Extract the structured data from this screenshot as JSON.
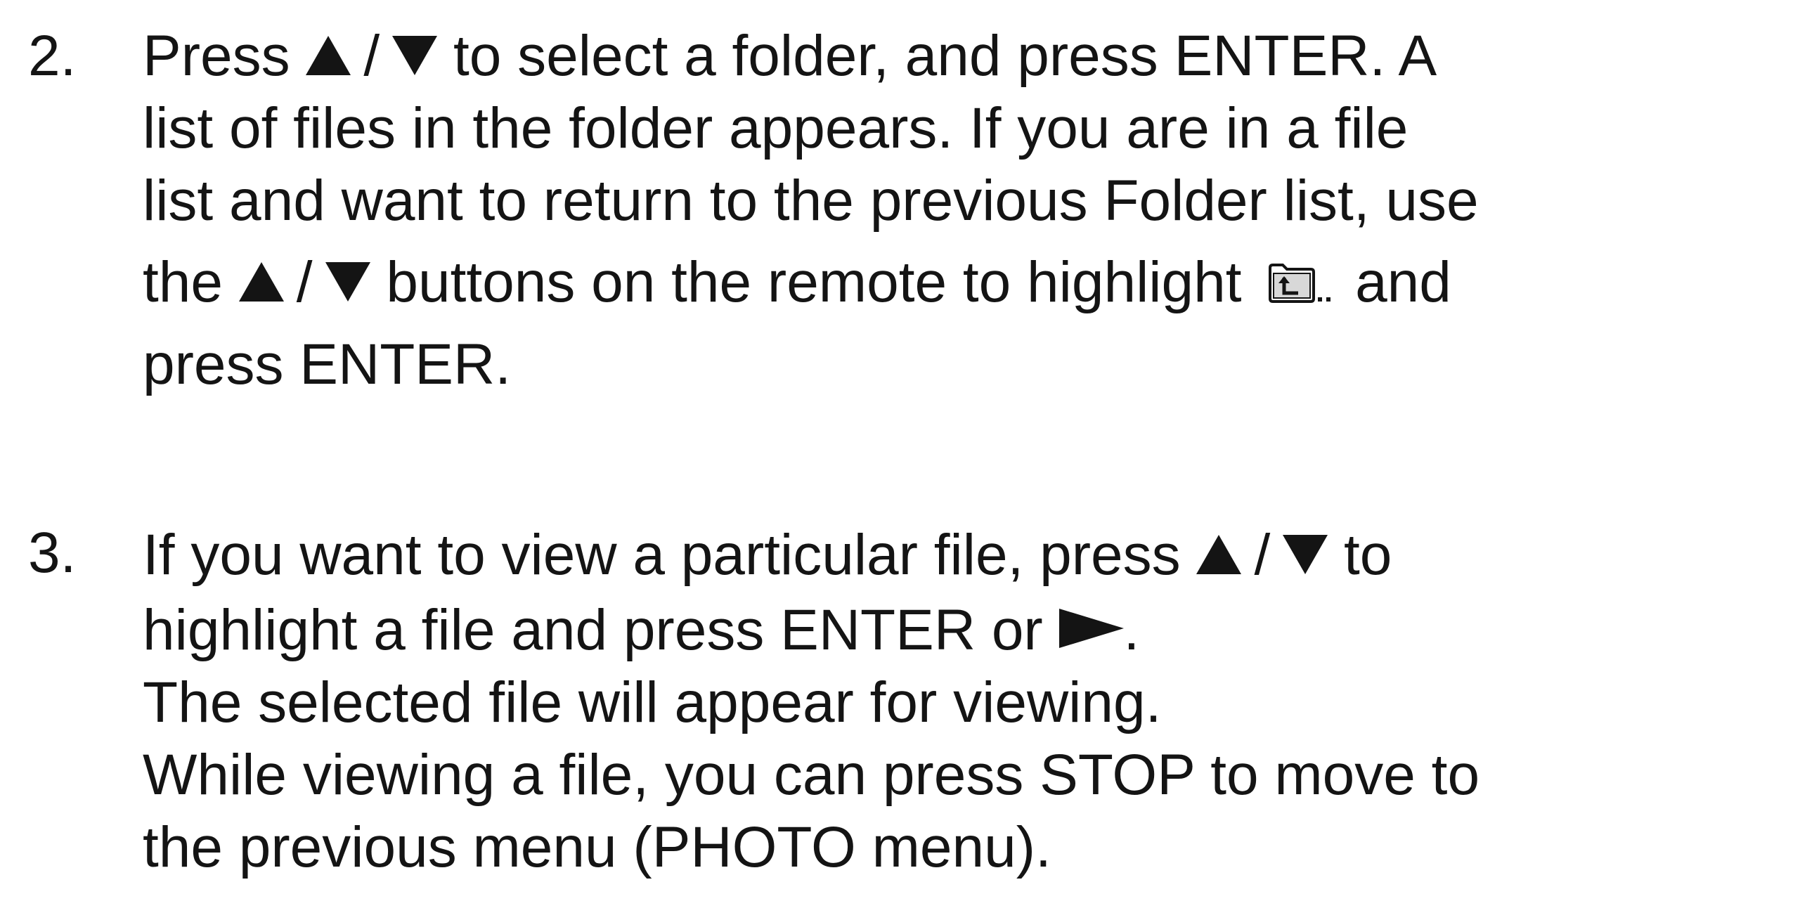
{
  "step2": {
    "number": "2.",
    "line1": {
      "pre": "Press ",
      "slash": "/",
      "post": " to select a folder, and press ENTER. A"
    },
    "line2": "list of files in the folder appears. If you are in a file",
    "line3": "list and want to return to the previous Folder list, use",
    "line4": {
      "pre": "the ",
      "slash": "/",
      "mid": " buttons on the remote to highlight ",
      "post": " and"
    },
    "line5": "press ENTER."
  },
  "step3": {
    "number": "3.",
    "line1": {
      "pre": "If you want to view a particular file, press ",
      "slash": "/",
      "post": " to"
    },
    "line2": {
      "pre": "highlight a file and press ENTER or ",
      "post": "."
    },
    "line3": "The selected file will appear for viewing.",
    "line4": "While viewing a file, you can press STOP to move to",
    "line5": "the previous menu (PHOTO menu)."
  },
  "icons": {
    "up": "up-arrow-icon",
    "down": "down-arrow-icon",
    "play": "play-icon",
    "parent_folder": "parent-folder-icon"
  },
  "colors": {
    "text": "#141414",
    "background": "#ffffff"
  }
}
